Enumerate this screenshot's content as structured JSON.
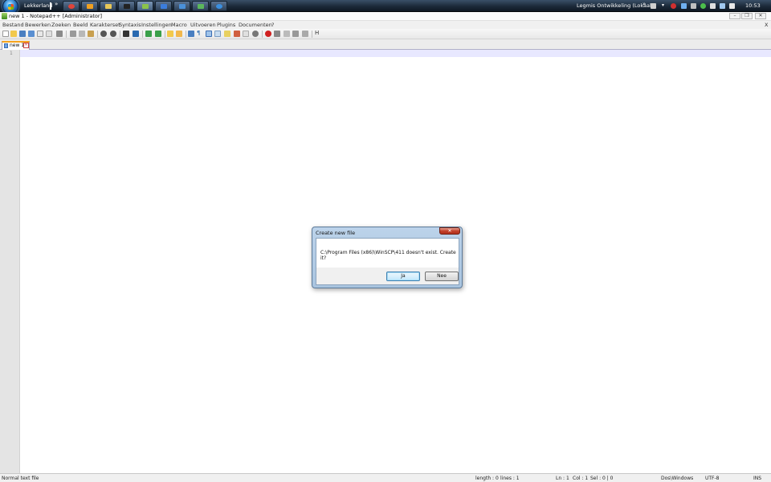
{
  "taskbar": {
    "toolbar_label": "Lekkerland",
    "toolbar_chevron": "»",
    "tray_label": "Legmis Ontwikkeling (Lokaal)",
    "tray_chevron": "»",
    "clock": "10:53",
    "buttons": [
      {
        "icon": "chrome-icon",
        "color": "#e0443a"
      },
      {
        "icon": "outlook-icon",
        "color": "#f0a020"
      },
      {
        "icon": "explorer-icon",
        "color": "#e8c858"
      },
      {
        "icon": "cmd-icon",
        "color": "#222222"
      },
      {
        "icon": "notepad-plus-icon",
        "color": "#8bc34a"
      },
      {
        "icon": "remote-desktop-icon",
        "color": "#3b7ddd"
      },
      {
        "icon": "network-icon",
        "color": "#4a90d9"
      },
      {
        "icon": "monitor-icon",
        "color": "#5cb85c"
      },
      {
        "icon": "ie-icon",
        "color": "#3a8fe0"
      }
    ]
  },
  "window": {
    "title": "new 1 - Notepad++ [Administrator]",
    "minimize": "–",
    "restore": "❐",
    "close": "✕"
  },
  "menu": {
    "items": [
      "Bestand",
      "Bewerken",
      "Zoeken",
      "Beeld",
      "Karakterset",
      "Syntaxis",
      "Instellingen",
      "Macro",
      "Uitvoeren",
      "Plugins",
      "Documenten",
      "?"
    ],
    "close": "X"
  },
  "tab": {
    "label": "new 1",
    "close": "✕"
  },
  "editor": {
    "line_number": "1"
  },
  "status": {
    "file_type": "Normal text file",
    "length": "length : 0",
    "lines": "lines : 1",
    "ln": "Ln : 1",
    "col": "Col : 1",
    "sel": "Sel : 0 | 0",
    "eol": "Dos\\Windows",
    "encoding": "UTF-8",
    "mode": "INS"
  },
  "dialog": {
    "title": "Create new file",
    "message": "C:\\Program Files (x86)\\WinSCP\\411 doesn't exist. Create it?",
    "yes_label": "Ja",
    "no_label": "Nee",
    "close": "✕"
  }
}
